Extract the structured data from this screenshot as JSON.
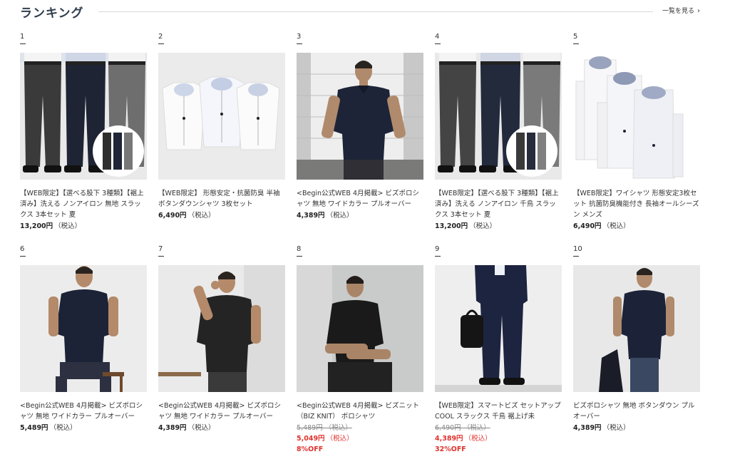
{
  "header": {
    "title": "ランキング",
    "more_label": "一覧を見る"
  },
  "products": [
    {
      "rank": "1",
      "name": "【WEB限定】【選べる股下 3種類】【裾上済み】洗える ノンアイロン 無地 スラックス 3本セット 夏",
      "price": "13,200円",
      "tax": "（税込）",
      "image": "slacks-gray-navy-charcoal"
    },
    {
      "rank": "2",
      "name": "【WEB限定】 形態安定・抗菌防臭 半袖ボタンダウンシャツ 3枚セット",
      "price": "6,490円",
      "tax": "（税込）",
      "image": "short-sleeve-shirts-3pack"
    },
    {
      "rank": "3",
      "name": "<Begin公式WEB 4月掲載> ビズポロシャツ 無地 ワイドカラー プルオーバー",
      "price": "4,389円",
      "tax": "（税込）",
      "image": "navy-polo-model"
    },
    {
      "rank": "4",
      "name": "【WEB限定】【選べる股下 3種類】【裾上済み】洗える ノンアイロン 千鳥 スラックス 3本セット 夏",
      "price": "13,200円",
      "tax": "（税込）",
      "image": "slacks-houndstooth"
    },
    {
      "rank": "5",
      "name": "【WEB限定】ワイシャツ 形態安定3枚セット 抗菌防臭機能付き 長袖オールシーズン メンズ",
      "price": "6,490円",
      "tax": "（税込）",
      "image": "long-sleeve-shirts-3pack"
    },
    {
      "rank": "6",
      "name": "<Begin公式WEB 4月掲載> ビズポロシャツ 無地 ワイドカラー プルオーバー",
      "price": "5,489円",
      "tax": "（税込）",
      "image": "navy-polo-seated"
    },
    {
      "rank": "7",
      "name": "<Begin公式WEB 4月掲載> ビズポロシャツ 無地 ワイドカラー プルオーバー",
      "price": "4,389円",
      "tax": "（税込）",
      "image": "black-polo-phone"
    },
    {
      "rank": "8",
      "name": "<Begin公式WEB 4月掲載> ビズニット（BIZ KNIT） ポロシャツ",
      "original_price": "5,489円 （税込）",
      "price": "5,049円",
      "tax": "（税込）",
      "discount": "8%OFF",
      "image": "black-knit-polo-seated"
    },
    {
      "rank": "9",
      "name": "【WEB限定】スマートビズ セットアップ COOL スラックス 千鳥 裾上げ未",
      "original_price": "6,490円 （税込）",
      "price": "4,389円",
      "tax": "（税込）",
      "discount": "32%OFF",
      "image": "navy-setup-bag"
    },
    {
      "rank": "10",
      "name": "ビズポロシャツ 無地 ボタンダウン プルオーバー",
      "price": "4,389円",
      "tax": "（税込）",
      "image": "navy-polo-jacket"
    }
  ],
  "colors": {
    "sale": "#e0322d",
    "title": "#2f3d4c"
  }
}
